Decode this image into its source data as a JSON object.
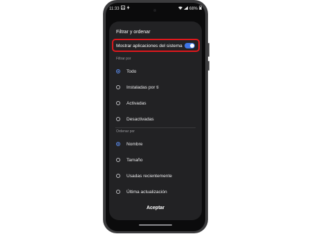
{
  "status_bar": {
    "time": "11:33",
    "left_icons": [
      "image-icon",
      "bolt-icon"
    ],
    "battery": "68%",
    "right_icons": [
      "wifi-icon",
      "signal-icon",
      "battery-icon"
    ]
  },
  "sheet": {
    "title": "Filtrar y ordenar",
    "toggle": {
      "label": "Mostrar aplicaciones del sistema",
      "on": true,
      "highlight_color": "#e0181c"
    },
    "filter_section": {
      "heading": "Filtrar por",
      "options": [
        {
          "label": "Todo",
          "selected": true
        },
        {
          "label": "Instaladas por ti",
          "selected": false
        },
        {
          "label": "Activadas",
          "selected": false
        },
        {
          "label": "Desactivadas",
          "selected": false
        }
      ]
    },
    "sort_section": {
      "heading": "Ordenar por",
      "options": [
        {
          "label": "Nombre",
          "selected": true
        },
        {
          "label": "Tamaño",
          "selected": false
        },
        {
          "label": "Usadas recientemente",
          "selected": false
        },
        {
          "label": "Última actualización",
          "selected": false
        }
      ]
    },
    "accept_label": "Aceptar"
  },
  "colors": {
    "accent": "#5b8df0",
    "sheet_bg": "#222224",
    "switch_on": "#3e74e6"
  }
}
